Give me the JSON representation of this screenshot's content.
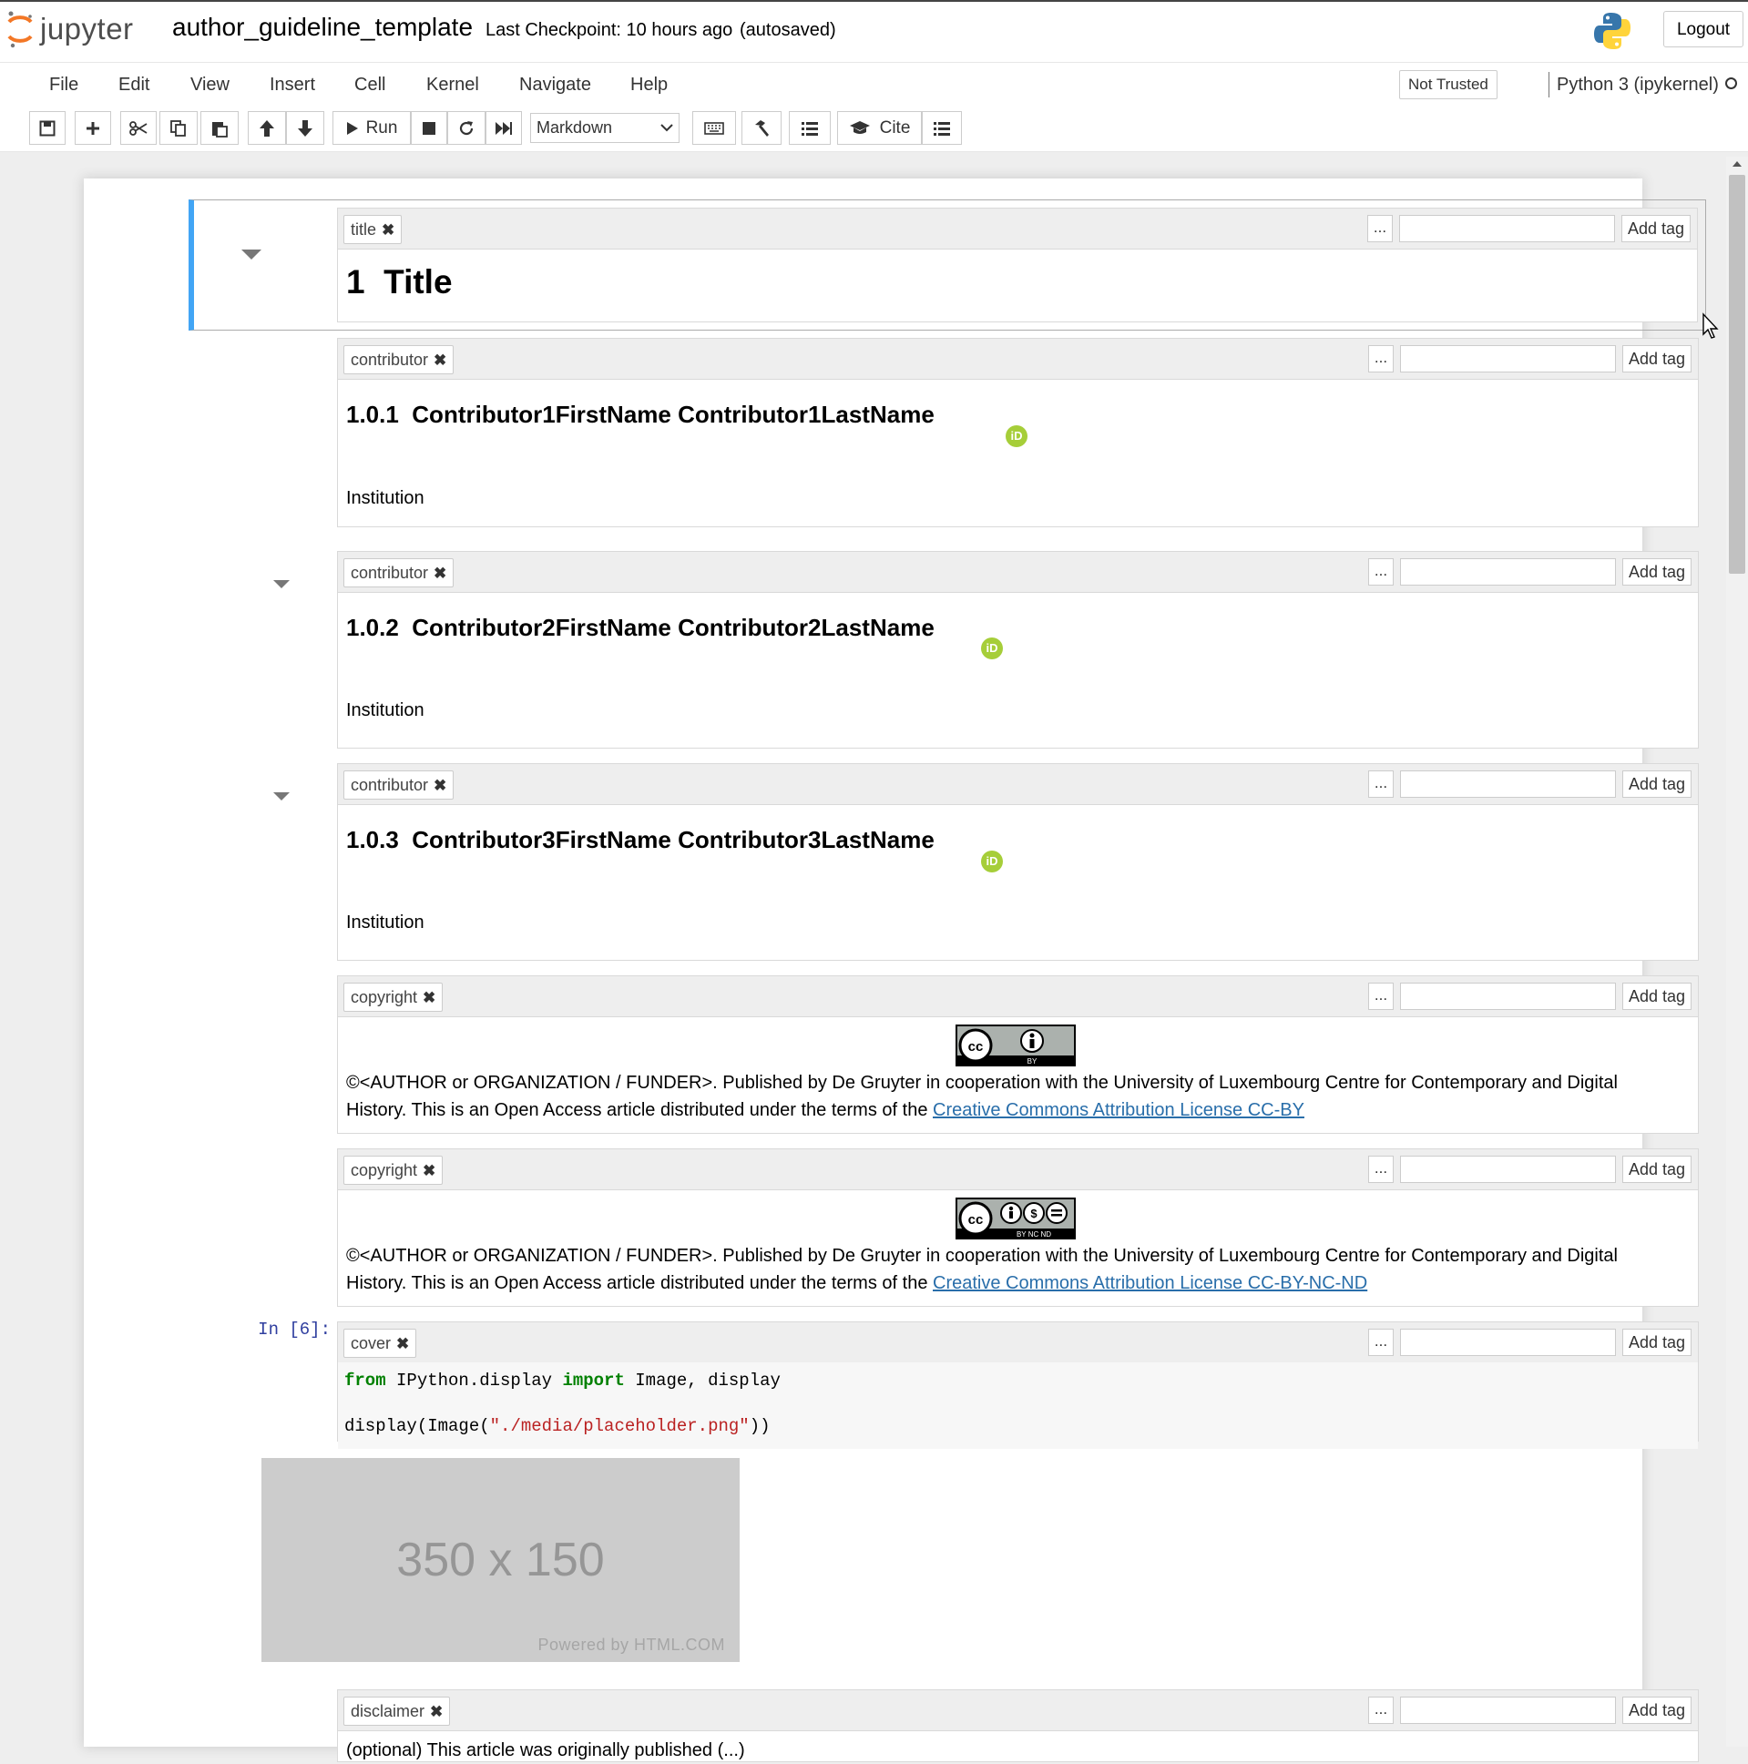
{
  "header": {
    "logo_text": "jupyter",
    "notebook_name": "author_guideline_template",
    "checkpoint": "Last Checkpoint: 10 hours ago",
    "autosave": "(autosaved)",
    "logout_label": "Logout"
  },
  "menubar": {
    "items": [
      "File",
      "Edit",
      "View",
      "Insert",
      "Cell",
      "Kernel",
      "Navigate",
      "Help"
    ],
    "trust_status": "Not Trusted",
    "kernel_name": "Python 3 (ipykernel)"
  },
  "toolbar": {
    "run_label": "Run",
    "cell_type": "Markdown",
    "cite_label": "Cite"
  },
  "tag_controls": {
    "more_label": "...",
    "add_tag_label": "Add tag",
    "remove_glyph": "✖"
  },
  "cells": [
    {
      "tag": "title",
      "heading_number": "1",
      "heading_text": "Title"
    },
    {
      "tag": "contributor",
      "heading_number": "1.0.1",
      "heading_text": "Contributor1FirstName Contributor1LastName",
      "institution": "Institution"
    },
    {
      "tag": "contributor",
      "heading_number": "1.0.2",
      "heading_text": "Contributor2FirstName Contributor2LastName",
      "institution": "Institution"
    },
    {
      "tag": "contributor",
      "heading_number": "1.0.3",
      "heading_text": "Contributor3FirstName Contributor3LastName",
      "institution": "Institution"
    },
    {
      "tag": "copyright",
      "badge": "BY",
      "text_line1": "©<AUTHOR or ORGANIZATION / FUNDER>. Published by De Gruyter in cooperation with the University of Luxembourg Centre for Contemporary and Digital",
      "text_line2": "History. This is an Open Access article distributed under the terms of the ",
      "link": "Creative Commons Attribution License CC-BY"
    },
    {
      "tag": "copyright",
      "badge": "BY NC ND",
      "text_line1": "©<AUTHOR or ORGANIZATION / FUNDER>. Published by De Gruyter in cooperation with the University of Luxembourg Centre for Contemporary and Digital",
      "text_line2": "History. This is an Open Access article distributed under the terms of the ",
      "link": "Creative Commons Attribution License CC-BY-NC-ND"
    },
    {
      "tag": "cover",
      "prompt": "In [6]:",
      "code_kw1": "from",
      "code_mod": " IPython.display ",
      "code_kw2": "import",
      "code_rest": " Image, display",
      "code_line2_a": "display(Image(",
      "code_line2_str": "\"./media/placeholder.png\"",
      "code_line2_b": "))",
      "output_image_text": "350 x 150",
      "output_image_caption": "Powered by HTML.COM"
    },
    {
      "tag": "disclaimer",
      "text": "(optional) This article was originally published (...)"
    }
  ],
  "colors": {
    "selected_cell_border": "#42a5f5",
    "jupyter_orange": "#f37726",
    "orcid_green": "#a6ce39",
    "link_blue": "#296eaa"
  },
  "icons": [
    "save-icon",
    "plus-icon",
    "cut-icon",
    "copy-icon",
    "paste-icon",
    "arrow-up-icon",
    "arrow-down-icon",
    "play-icon",
    "stop-icon",
    "restart-icon",
    "fast-forward-icon",
    "keyboard-icon",
    "hammer-icon",
    "list-icon",
    "graduation-cap-icon",
    "python-logo-icon",
    "orcid-icon",
    "cc-license-icon"
  ]
}
